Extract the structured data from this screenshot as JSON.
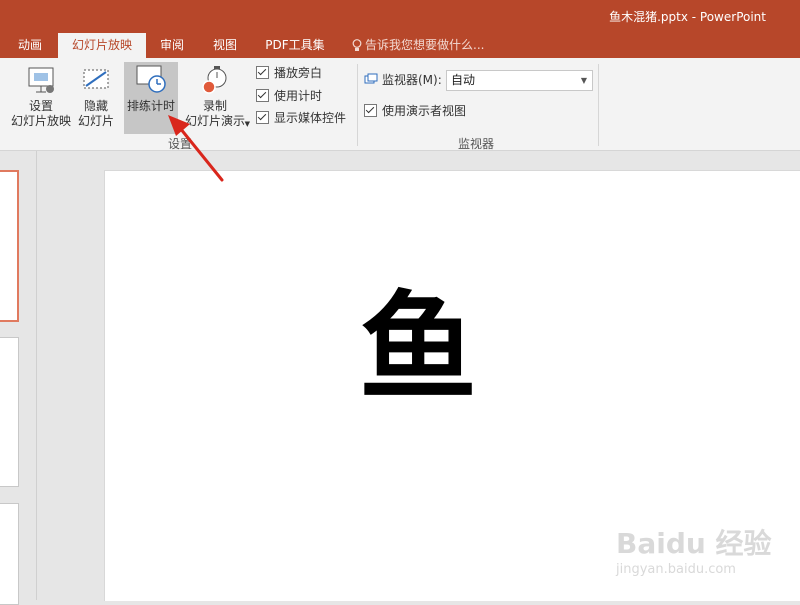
{
  "window": {
    "title": "鱼木混猪.pptx - PowerPoint"
  },
  "tabs": [
    {
      "label": "动画",
      "active": false
    },
    {
      "label": "幻灯片放映",
      "active": true
    },
    {
      "label": "审阅",
      "active": false
    },
    {
      "label": "视图",
      "active": false
    },
    {
      "label": "PDF工具集",
      "active": false
    }
  ],
  "tellme": {
    "placeholder": "告诉我您想要做什么..."
  },
  "ribbon": {
    "setup_show_label": "设置\n幻灯片放映",
    "hide_slide_label": "隐藏\n幻灯片",
    "rehearse_timings_label": "排练计时",
    "record_show_label": "录制\n幻灯片演示",
    "checkboxes": [
      {
        "label": "播放旁白",
        "checked": true
      },
      {
        "label": "使用计时",
        "checked": true
      },
      {
        "label": "显示媒体控件",
        "checked": true
      }
    ],
    "setup_group_label": "设置",
    "monitor_label": "监视器(M):",
    "monitor_value": "自动",
    "presenter_view_label": "使用演示者视图",
    "presenter_view_checked": true,
    "monitors_group_label": "监视器"
  },
  "slide": {
    "text": "鱼"
  },
  "watermark": {
    "main": "Baidu 经验",
    "sub": "jingyan.baidu.com"
  },
  "colors": {
    "accent": "#b7472a",
    "highlight": "#c6c6c6",
    "thumb_selected": "#e07a5f",
    "arrow": "#d9261c"
  }
}
